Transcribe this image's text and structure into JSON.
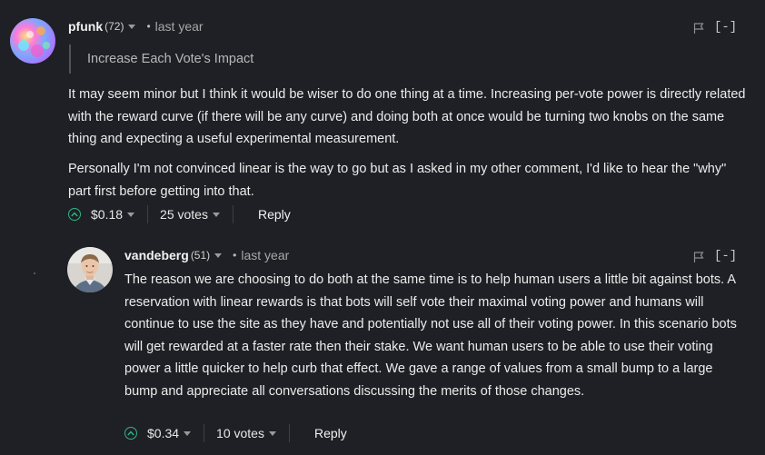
{
  "comments": [
    {
      "author": "pfunk",
      "reputation": "(72)",
      "time": "last year",
      "quote": "Increase Each Vote's Impact",
      "paragraphs": [
        "It may seem minor but I think it would be wiser to do one thing at a time. Increasing per-vote power is directly related with the reward curve (if there will be any curve) and doing both at once would be turning two knobs on the same thing and expecting a useful experimental measurement.",
        "Personally I'm not convinced linear is the way to go but as I asked in my other comment, I'd like to hear the \"why\" part first before getting into that."
      ],
      "payout": "$0.18",
      "votes": "25 votes",
      "reply_label": "Reply",
      "collapse_label": "[-]"
    },
    {
      "author": "vandeberg",
      "reputation": "(51)",
      "time": "last year",
      "paragraphs": [
        "The reason we are choosing to do both at the same time is to help human users a little bit against bots. A reservation with linear rewards is that bots will self vote their maximal voting power and humans will continue to use the site as they have and potentially not use all of their voting power. In this scenario bots will get rewarded at a faster rate then their stake. We want human users to be able to use their voting power a little quicker to help curb that effect. We gave a range of values from a small bump to a large bump and appreciate all conversations discussing the merits of those changes."
      ],
      "payout": "$0.34",
      "votes": "10 votes",
      "reply_label": "Reply",
      "collapse_label": "[-]"
    }
  ],
  "colors": {
    "background": "#1e2025",
    "upvote_accent": "#2fb686"
  },
  "icons": [
    "flag-icon",
    "upvote-icon",
    "chevron-down-icon"
  ]
}
